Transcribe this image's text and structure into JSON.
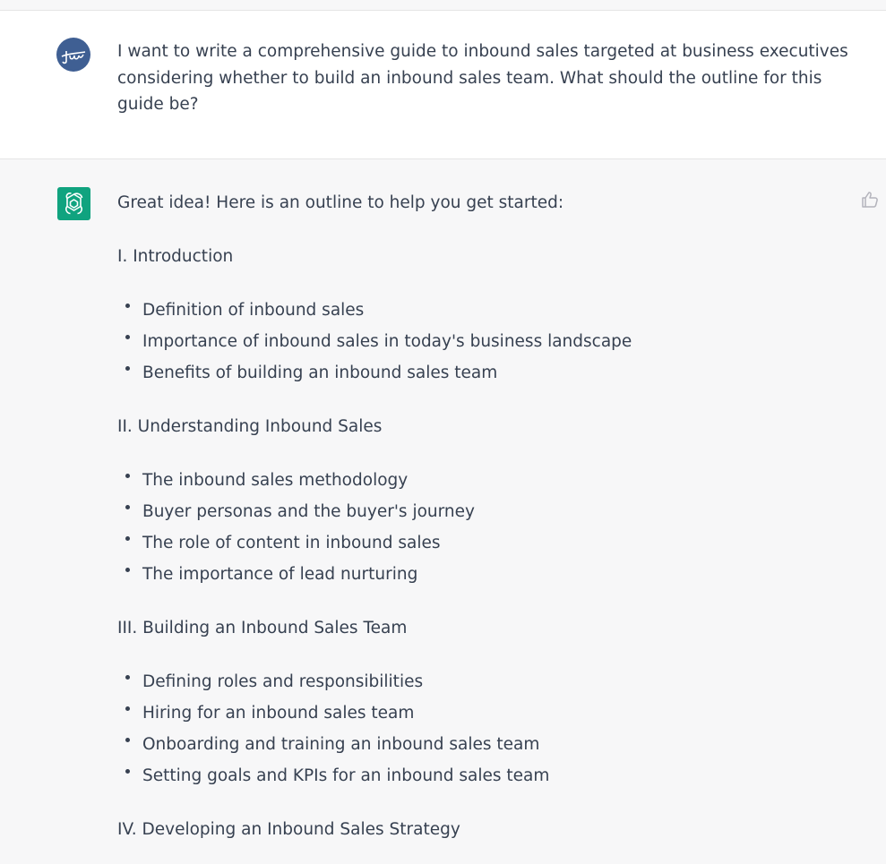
{
  "user_message": {
    "text": "I want to write a comprehensive guide to inbound sales targeted at business executives considering whether to build an inbound sales team. What should the outline for this guide be?"
  },
  "assistant_message": {
    "intro": "Great idea! Here is an outline to help you get started:",
    "sections": [
      {
        "heading": "I. Introduction",
        "items": [
          "Definition of inbound sales",
          "Importance of inbound sales in today's business landscape",
          "Benefits of building an inbound sales team"
        ]
      },
      {
        "heading": "II. Understanding Inbound Sales",
        "items": [
          "The inbound sales methodology",
          "Buyer personas and the buyer's journey",
          "The role of content in inbound sales",
          "The importance of lead nurturing"
        ]
      },
      {
        "heading": "III. Building an Inbound Sales Team",
        "items": [
          "Defining roles and responsibilities",
          "Hiring for an inbound sales team",
          "Onboarding and training an inbound sales team",
          "Setting goals and KPIs for an inbound sales team"
        ]
      },
      {
        "heading": "IV. Developing an Inbound Sales Strategy",
        "items": []
      }
    ]
  },
  "colors": {
    "user_avatar": "#3f5f93",
    "assistant_avatar": "#10a37f",
    "assistant_bg": "#f7f7f8",
    "text": "#374151"
  },
  "icons": {
    "user_avatar": "user-avatar-icon",
    "assistant_avatar": "openai-logo-icon",
    "feedback": "thumbs-up-icon"
  }
}
